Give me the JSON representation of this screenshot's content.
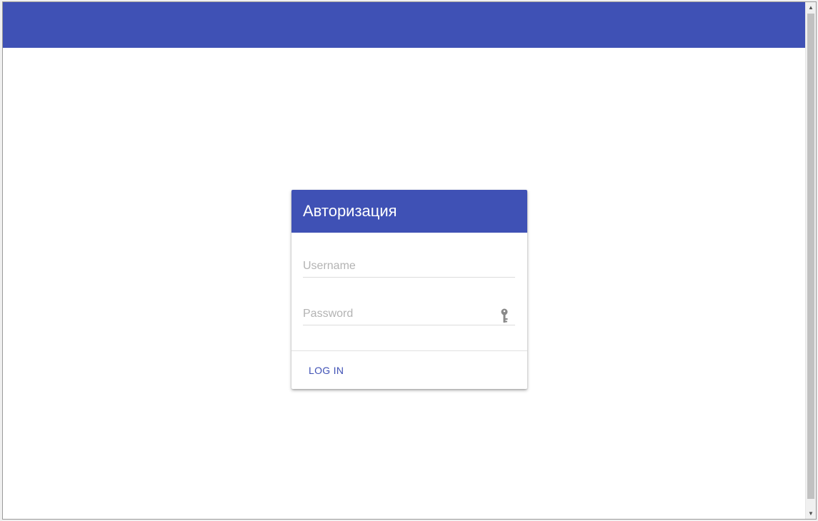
{
  "colors": {
    "primary": "#3f51b5",
    "background": "#ffffff",
    "placeholder": "#b3b3b3",
    "divider": "#e0e0e0"
  },
  "login_card": {
    "title": "Авторизация",
    "username": {
      "value": "",
      "placeholder": "Username"
    },
    "password": {
      "value": "",
      "placeholder": "Password",
      "icon": "key-icon"
    },
    "login_label": "LOG IN"
  },
  "scrollbar": {
    "up_icon": "scroll-up-arrow-icon",
    "down_icon": "scroll-down-arrow-icon"
  }
}
